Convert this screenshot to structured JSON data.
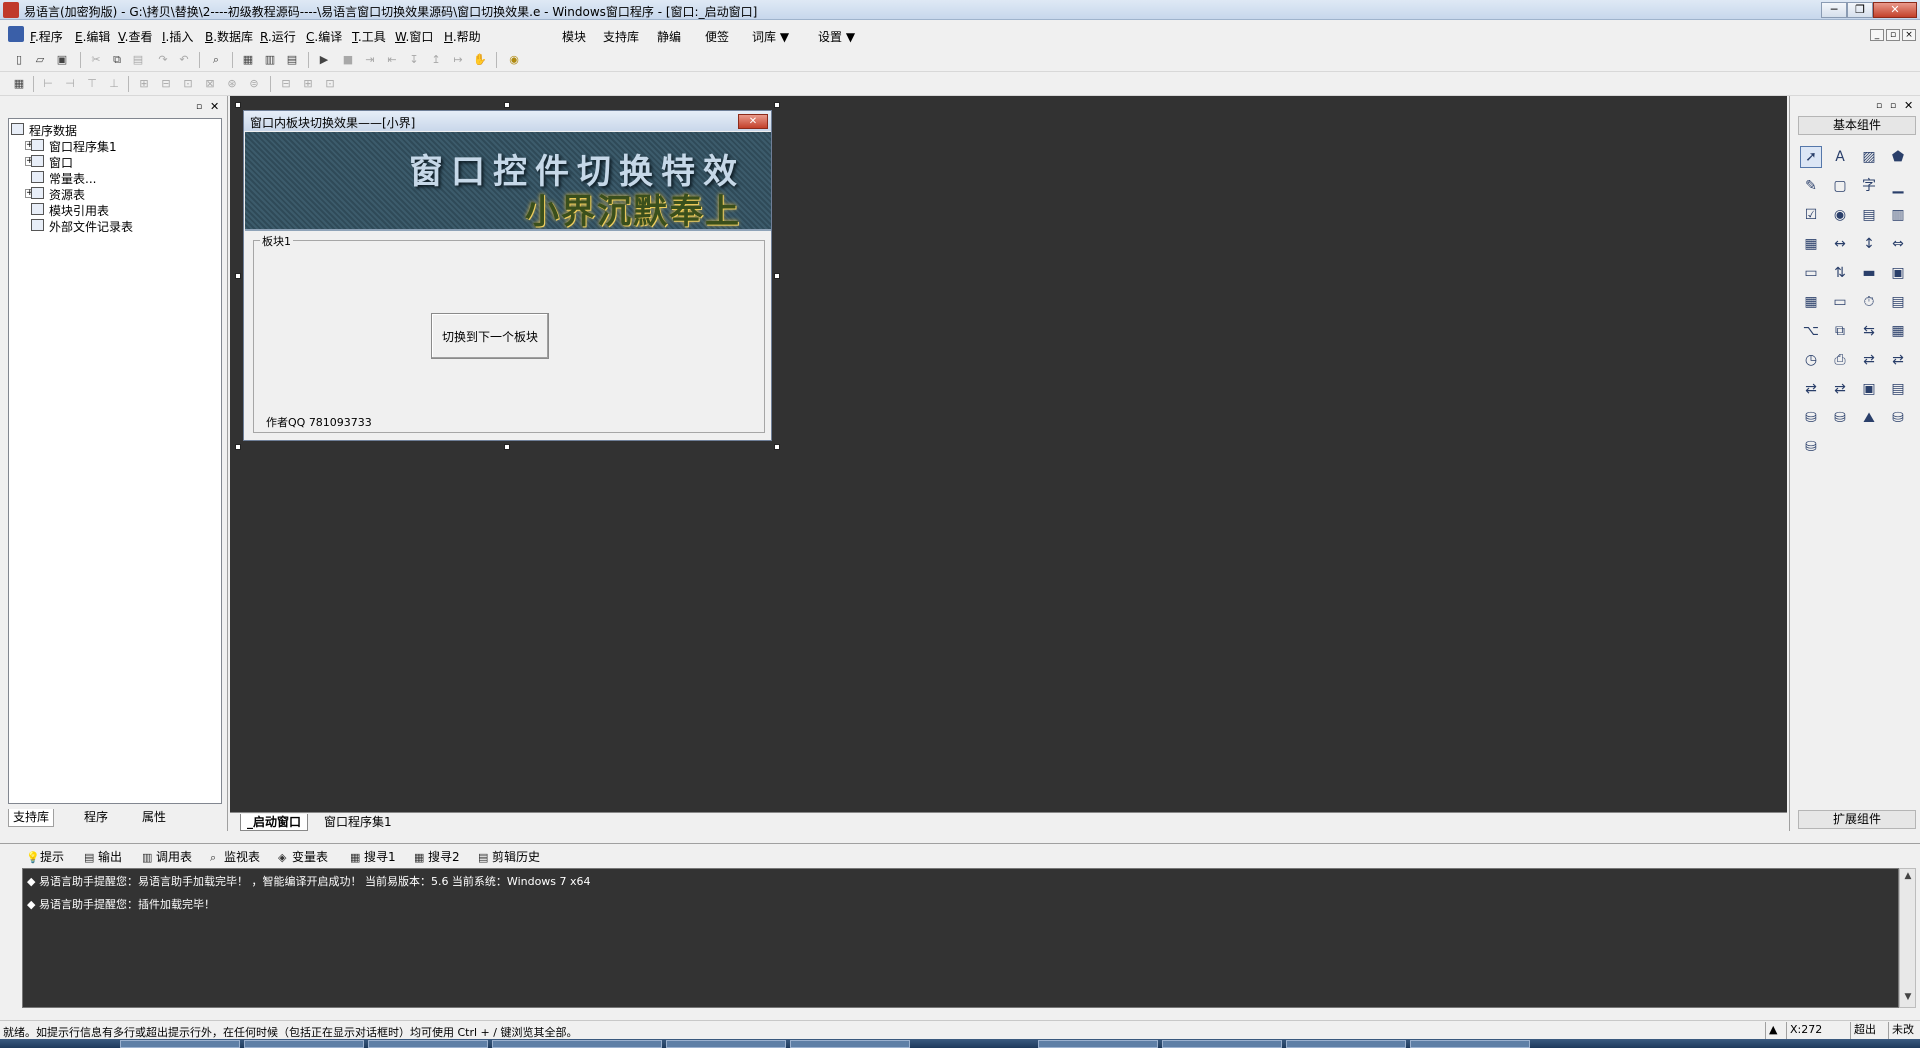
{
  "window": {
    "title": "易语言(加密狗版) - G:\\拷贝\\替换\\2----初级教程源码----\\易语言窗口切换效果源码\\窗口切换效果.e - Windows窗口程序 - [窗口:_启动窗口]",
    "min_glyph": "─",
    "max_glyph": "❐",
    "close_glyph": "✕"
  },
  "menu": {
    "items": [
      {
        "key": "F",
        "rest": ".程序"
      },
      {
        "key": "E",
        "rest": ".编辑"
      },
      {
        "key": "V",
        "rest": ".查看"
      },
      {
        "key": "I",
        "rest": ".插入"
      },
      {
        "key": "B",
        "rest": ".数据库"
      },
      {
        "key": "R",
        "rest": ".运行"
      },
      {
        "key": "C",
        "rest": ".编译"
      },
      {
        "key": "T",
        "rest": ".工具"
      },
      {
        "key": "W",
        "rest": ".窗口"
      },
      {
        "key": "H",
        "rest": ".帮助"
      }
    ],
    "extras": [
      "模块",
      "支持库",
      "静编",
      "便签",
      "词库 ▼",
      "设置 ▼"
    ]
  },
  "left_panel": {
    "tree": [
      {
        "label": "程序数据",
        "icon": "database-icon",
        "expander": ""
      },
      {
        "label": "窗口程序集1",
        "icon": "module-icon",
        "expander": "+"
      },
      {
        "label": "窗口",
        "icon": "window-icon",
        "expander": "+"
      },
      {
        "label": "常量表...",
        "icon": "constant-table-icon",
        "expander": ""
      },
      {
        "label": "资源表",
        "icon": "resource-icon",
        "expander": "+"
      },
      {
        "label": "模块引用表",
        "icon": "module-ref-icon",
        "expander": ""
      },
      {
        "label": "外部文件记录表",
        "icon": "file-record-icon",
        "expander": ""
      }
    ],
    "tabs": [
      "支持库",
      "程序",
      "属性"
    ]
  },
  "form": {
    "title": "窗口内板块切换效果——[小界]",
    "banner_line1": "窗口控件切换特效",
    "banner_line2": "小界沉默奉上",
    "group_label": "板块1",
    "button_label": "切换到下一个板块",
    "author": "作者QQ 781093733"
  },
  "doc_tabs": [
    "_启动窗口",
    "窗口程序集1"
  ],
  "right_panel": {
    "title": "基本组件",
    "footer": "扩展组件",
    "components": [
      "cursor-icon",
      "label-icon",
      "picture-icon",
      "shape-icon",
      "edit-icon",
      "blank-icon",
      "text-icon",
      "line-icon",
      "checkbox-icon",
      "radio-icon",
      "list-icon",
      "combo-icon",
      "grid-icon",
      "scroll-icon",
      "vscroll-icon",
      "hscroll-icon",
      "ruler-icon",
      "step-icon",
      "progress-icon",
      "frame-icon",
      "table-icon",
      "field-icon",
      "timer-icon",
      "doc-icon",
      "tree-icon",
      "layer-icon",
      "split-icon",
      "calendar-icon",
      "clock-icon",
      "printer-icon",
      "net-a-icon",
      "net-b-icon",
      "net-c-icon",
      "net-d-icon",
      "panel-icon",
      "card-icon",
      "db-a-icon",
      "db-b-icon",
      "chart-icon",
      "odbc-a-icon",
      "odbc-b-icon"
    ]
  },
  "output": {
    "tabs": [
      "提示",
      "输出",
      "调用表",
      "监视表",
      "变量表",
      "搜寻1",
      "搜寻2",
      "剪辑历史"
    ],
    "lines": [
      "◆ 易语言助手提醒您：易语言助手加载完毕！ ，智能编译开启成功！  当前易版本：5.6  当前系统：Windows 7 x64",
      "◆ 易语言助手提醒您：插件加载完毕！"
    ]
  },
  "status": {
    "text": "就绪。如提示行信息有多行或超出提示行外，在任何时候（包括正在显示对话框时）均可使用 Ctrl + / 键浏览其全部。",
    "pos": "X:272",
    "mode": "超出",
    "state": "未改"
  }
}
